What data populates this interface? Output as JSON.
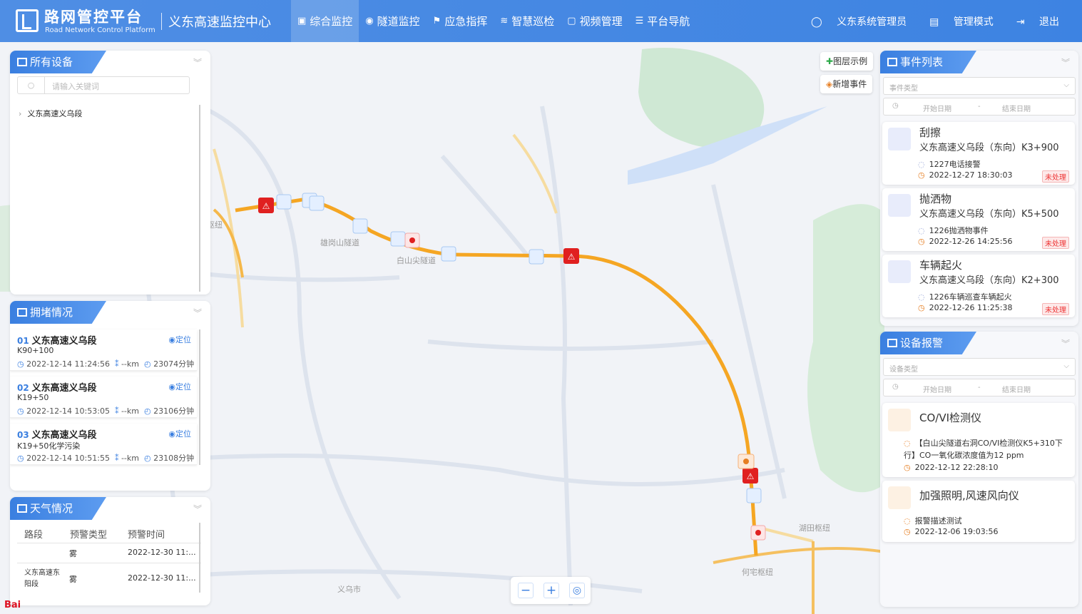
{
  "header": {
    "brand_title": "路网管控平台",
    "brand_subtitle": "Road Network Control Platform",
    "center_name": "义东高速监控中心",
    "nav": [
      {
        "label": "综合监控",
        "icon": "monitor-icon",
        "active": true
      },
      {
        "label": "隧道监控",
        "icon": "pin-icon",
        "active": false
      },
      {
        "label": "应急指挥",
        "icon": "flag-icon",
        "active": false
      },
      {
        "label": "智慧巡检",
        "icon": "layers-icon",
        "active": false
      },
      {
        "label": "视频管理",
        "icon": "video-icon",
        "active": false
      },
      {
        "label": "平台导航",
        "icon": "list-icon",
        "active": false
      }
    ],
    "user_name": "义东系统管理员",
    "manage_mode": "管理模式",
    "logout": "退出"
  },
  "devices": {
    "title": "所有设备",
    "search_placeholder": "请输入关键词",
    "tree_root": "义东高速义乌段"
  },
  "congestion": {
    "title": "拥堵情况",
    "locate_label": "定位",
    "items": [
      {
        "no": "01",
        "name": "义东高速义乌段",
        "pos": "K90+100",
        "time": "2022-12-14 11:24:56",
        "km": "--km",
        "duration": "23074分钟"
      },
      {
        "no": "02",
        "name": "义东高速义乌段",
        "pos": "K19+50",
        "time": "2022-12-14 10:53:05",
        "km": "--km",
        "duration": "23106分钟"
      },
      {
        "no": "03",
        "name": "义东高速义乌段",
        "pos": "K19+50化学污染",
        "time": "2022-12-14 10:51:55",
        "km": "--km",
        "duration": "23108分钟"
      }
    ]
  },
  "weather": {
    "title": "天气情况",
    "headers": [
      "路段",
      "预警类型",
      "预警时间"
    ],
    "rows": [
      {
        "road": "",
        "type": "雾",
        "time": "2022-12-30 11:..."
      },
      {
        "road": "义东高速东阳段",
        "type": "雾",
        "time": "2022-12-30 11:..."
      }
    ]
  },
  "map": {
    "legend_btn": "图层示例",
    "add_event_btn": "新增事件",
    "labels": [
      "雄岗山隧道",
      "白山尖隧道",
      "湖田枢纽",
      "何宅枢纽",
      "义乌市",
      "苏溪枢纽"
    ],
    "baidu": "Bai"
  },
  "events": {
    "title": "事件列表",
    "type_placeholder": "事件类型",
    "start_date": "开始日期",
    "date_sep": "-",
    "end_date": "结束日期",
    "items": [
      {
        "title": "刮擦",
        "location": "义东高速义乌段（东向）K3+900",
        "desc": "1227电话接警",
        "time": "2022-12-27 18:30:03",
        "status": "未处理",
        "icon": "car-crash-icon"
      },
      {
        "title": "抛洒物",
        "location": "义东高速义乌段（东向）K5+500",
        "desc": "1226抛洒物事件",
        "time": "2022-12-26 14:25:56",
        "status": "未处理",
        "icon": "debris-icon"
      },
      {
        "title": "车辆起火",
        "location": "义东高速义乌段（东向）K2+300",
        "desc": "1226车辆巡查车辆起火",
        "time": "2022-12-26 11:25:38",
        "status": "未处理",
        "icon": "car-fire-icon"
      }
    ]
  },
  "alarms": {
    "title": "设备报警",
    "type_placeholder": "设备类型",
    "start_date": "开始日期",
    "date_sep": "-",
    "end_date": "结束日期",
    "items": [
      {
        "title": "CO/VI检测仪",
        "desc": "【白山尖隧道右洞CO/VI检测仪K5+310下行】CO一氧化碳浓度值为12 ppm",
        "time": "2022-12-12 22:28:10"
      },
      {
        "title": "加强照明,风速风向仪",
        "desc": "报警描述测试",
        "time": "2022-12-06 19:03:56"
      }
    ]
  },
  "colors": {
    "primary": "#3d83e2",
    "highway": "#f5a623",
    "alert": "#e02020",
    "pending": "#e33333"
  }
}
